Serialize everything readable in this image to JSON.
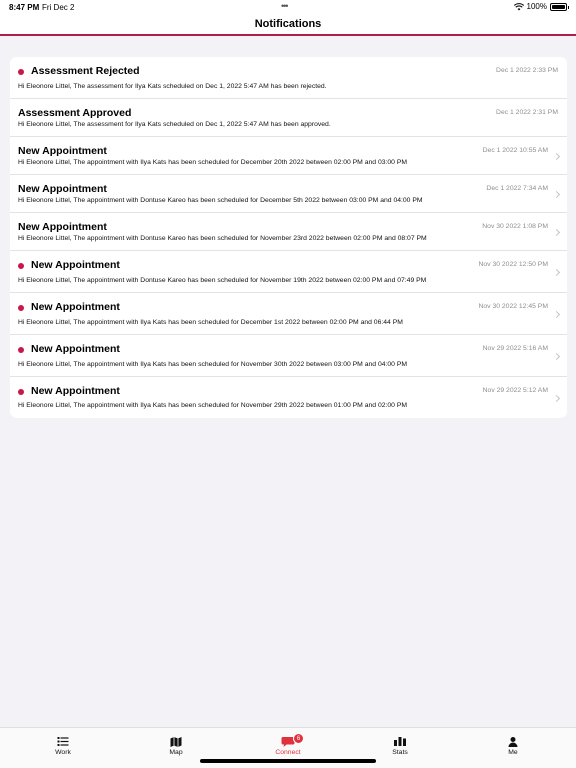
{
  "status_bar": {
    "time": "8:47 PM",
    "date": "Fri Dec 2",
    "dots": "•••",
    "battery": "100%",
    "wifi_icon": "wifi-icon",
    "battery_icon": "battery-icon"
  },
  "nav": {
    "title": "Notifications"
  },
  "notifications": [
    {
      "title": "Assessment Rejected",
      "time": "Dec 1 2022 2:33 PM",
      "body": "Hi Eleonore Littel, The assessment for Ilya Kats scheduled on Dec 1, 2022 5:47 AM has been rejected.",
      "unread": true,
      "chevron": false
    },
    {
      "title": "Assessment Approved",
      "time": "Dec 1 2022 2:31 PM",
      "body": "Hi Eleonore Littel, The assessment for Ilya Kats scheduled on Dec 1, 2022 5:47 AM has been approved.",
      "unread": false,
      "chevron": false
    },
    {
      "title": "New Appointment",
      "time": "Dec 1 2022 10:55 AM",
      "body": "Hi Eleonore Littel, The appointment with Ilya Kats has been scheduled for December 20th 2022 between 02:00 PM and 03:00 PM",
      "unread": false,
      "chevron": true
    },
    {
      "title": "New Appointment",
      "time": "Dec 1 2022 7:34 AM",
      "body": "Hi Eleonore Littel, The appointment with Dontuse Kareo has been scheduled for December 5th 2022 between 03:00 PM and 04:00 PM",
      "unread": false,
      "chevron": true
    },
    {
      "title": "New Appointment",
      "time": "Nov 30 2022 1:08 PM",
      "body": "Hi Eleonore Littel, The appointment with Dontuse Kareo has been scheduled for November 23rd 2022 between 02:00 PM and 08:07 PM",
      "unread": false,
      "chevron": true
    },
    {
      "title": "New Appointment",
      "time": "Nov 30 2022 12:50 PM",
      "body": "Hi Eleonore Littel, The appointment with Dontuse Kareo has been scheduled for November 19th 2022 between 02:00 PM and 07:49 PM",
      "unread": true,
      "chevron": true
    },
    {
      "title": "New Appointment",
      "time": "Nov 30 2022 12:45 PM",
      "body": "Hi Eleonore Littel, The appointment with Ilya Kats has been scheduled for December 1st 2022 between 02:00 PM and 06:44 PM",
      "unread": true,
      "chevron": true
    },
    {
      "title": "New Appointment",
      "time": "Nov 29 2022 5:16 AM",
      "body": "Hi Eleonore Littel, The appointment with Ilya Kats has been scheduled for November 30th 2022 between 03:00 PM and 04:00 PM",
      "unread": true,
      "chevron": true
    },
    {
      "title": "New Appointment",
      "time": "Nov 29 2022 5:12 AM",
      "body": "Hi Eleonore Littel, The appointment with Ilya Kats has been scheduled for November 29th 2022 between 01:00 PM and 02:00 PM",
      "unread": true,
      "chevron": true
    }
  ],
  "tabs": [
    {
      "label": "Work",
      "icon": "list-icon",
      "active": false
    },
    {
      "label": "Map",
      "icon": "map-icon",
      "active": false
    },
    {
      "label": "Connect",
      "icon": "chat-icon",
      "active": true,
      "badge": "6"
    },
    {
      "label": "Stats",
      "icon": "bar-chart-icon",
      "active": false
    },
    {
      "label": "Me",
      "icon": "person-icon",
      "active": false
    }
  ],
  "colors": {
    "accent": "#b01d4d",
    "unread_dot": "#c8174a",
    "active_tab": "#e0323c",
    "background": "#f2f2f7"
  }
}
